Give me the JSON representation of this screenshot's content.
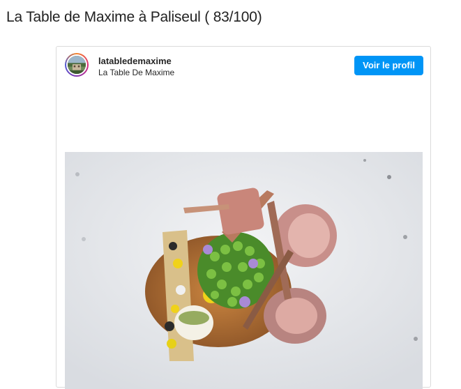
{
  "page": {
    "title": "La Table de Maxime à Paliseul ( 83/100)"
  },
  "embed": {
    "username": "latabledemaxime",
    "fullname": "La Table De Maxime",
    "profile_button_label": "Voir le profil",
    "avatar_icon": "avatar-icon",
    "accent_color": "#0095f6"
  }
}
